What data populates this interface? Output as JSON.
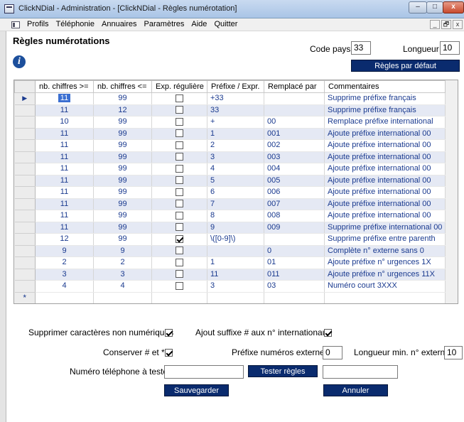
{
  "window": {
    "title": "ClickNDial - Administration - [ClickNDial - Règles numérotation]",
    "min": "–",
    "max": "□",
    "close": "x"
  },
  "menu": [
    "Profils",
    "Téléphonie",
    "Annuaires",
    "Paramètres",
    "Aide",
    "Quitter"
  ],
  "mdi": [
    "_",
    "🗗",
    "x"
  ],
  "header": {
    "title": "Règles numérotations",
    "code_pays_label": "Code pays",
    "code_pays_value": "33",
    "longueur_label": "Longueur",
    "longueur_value": "10",
    "defaults_button": "Règles par défaut"
  },
  "grid": {
    "columns": [
      "nb. chiffres >=",
      "nb. chiffres <=",
      "Exp. régulière",
      "Préfixe / Expr.",
      "Remplacé par",
      "Commentaires"
    ],
    "rows": [
      {
        "min": "11",
        "max": "99",
        "regex": false,
        "prefix": "+33",
        "replace": "",
        "comment": "Supprime préfixe français"
      },
      {
        "min": "11",
        "max": "12",
        "regex": false,
        "prefix": "33",
        "replace": "",
        "comment": "Supprime préfixe français"
      },
      {
        "min": "10",
        "max": "99",
        "regex": false,
        "prefix": "+",
        "replace": "00",
        "comment": "Remplace préfixe international"
      },
      {
        "min": "11",
        "max": "99",
        "regex": false,
        "prefix": "1",
        "replace": "001",
        "comment": "Ajoute préfixe international 00"
      },
      {
        "min": "11",
        "max": "99",
        "regex": false,
        "prefix": "2",
        "replace": "002",
        "comment": "Ajoute préfixe international 00"
      },
      {
        "min": "11",
        "max": "99",
        "regex": false,
        "prefix": "3",
        "replace": "003",
        "comment": "Ajoute préfixe international 00"
      },
      {
        "min": "11",
        "max": "99",
        "regex": false,
        "prefix": "4",
        "replace": "004",
        "comment": "Ajoute préfixe international 00"
      },
      {
        "min": "11",
        "max": "99",
        "regex": false,
        "prefix": "5",
        "replace": "005",
        "comment": "Ajoute préfixe international 00"
      },
      {
        "min": "11",
        "max": "99",
        "regex": false,
        "prefix": "6",
        "replace": "006",
        "comment": "Ajoute préfixe international 00"
      },
      {
        "min": "11",
        "max": "99",
        "regex": false,
        "prefix": "7",
        "replace": "007",
        "comment": "Ajoute préfixe international 00"
      },
      {
        "min": "11",
        "max": "99",
        "regex": false,
        "prefix": "8",
        "replace": "008",
        "comment": "Ajoute préfixe international 00"
      },
      {
        "min": "11",
        "max": "99",
        "regex": false,
        "prefix": "9",
        "replace": "009",
        "comment": "Supprime préfixe international 00"
      },
      {
        "min": "12",
        "max": "99",
        "regex": true,
        "prefix": "\\([0-9]\\)",
        "replace": "",
        "comment": "Supprime préfixe entre parenth"
      },
      {
        "min": "9",
        "max": "9",
        "regex": false,
        "prefix": "",
        "replace": "0",
        "comment": "Complète n° externe sans 0"
      },
      {
        "min": "2",
        "max": "2",
        "regex": false,
        "prefix": "1",
        "replace": "01",
        "comment": "Ajoute préfixe n° urgences 1X"
      },
      {
        "min": "3",
        "max": "3",
        "regex": false,
        "prefix": "11",
        "replace": "011",
        "comment": "Ajoute préfixe n° urgences 11X"
      },
      {
        "min": "4",
        "max": "4",
        "regex": false,
        "prefix": "3",
        "replace": "03",
        "comment": "Numéro court 3XXX"
      }
    ],
    "current_marker": "▶",
    "new_marker": "*"
  },
  "options": {
    "strip_non_numeric_label": "Supprimer caractères non numériques",
    "strip_non_numeric": true,
    "hash_suffix_label": "Ajout suffixe # aux n° internationaux",
    "hash_suffix": true,
    "keep_hash_star_label": "Conserver # et *",
    "keep_hash_star": true,
    "ext_prefix_label": "Préfixe numéros externes",
    "ext_prefix_value": "0",
    "min_length_label": "Longueur min. n° externe",
    "min_length_value": "10",
    "test_label": "Numéro téléphone à tester",
    "test_input_value": "",
    "test_button": "Tester règles",
    "test_result_value": ""
  },
  "buttons": {
    "save": "Sauvegarder",
    "cancel": "Annuler"
  }
}
